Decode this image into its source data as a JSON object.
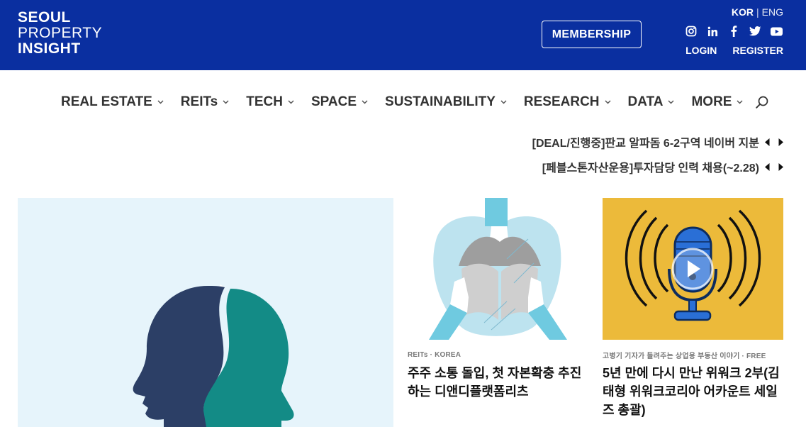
{
  "header": {
    "logo_line1": "SEOUL",
    "logo_line2": "PROPERTY",
    "logo_line3": "INSIGHT",
    "membership_label": "MEMBERSHIP",
    "lang_kor": "KOR",
    "lang_sep": "|",
    "lang_eng": "ENG",
    "login_label": "LOGIN",
    "register_label": "REGISTER",
    "socials": [
      "instagram-icon",
      "linkedin-icon",
      "facebook-icon",
      "twitter-icon",
      "youtube-icon"
    ]
  },
  "nav": {
    "items": [
      {
        "label": "REAL ESTATE"
      },
      {
        "label": "REITs"
      },
      {
        "label": "TECH"
      },
      {
        "label": "SPACE"
      },
      {
        "label": "SUSTAINABILITY"
      },
      {
        "label": "RESEARCH"
      },
      {
        "label": "DATA"
      },
      {
        "label": "MORE"
      }
    ]
  },
  "ticker": {
    "items": [
      "[DEAL/진행중]판교 알파돔 6-2구역 네이버 지분",
      "[페블스톤자산운용]투자담당 인력 채용(~2.28)"
    ]
  },
  "articles": [
    {
      "meta": "REITs · KOREA",
      "title": "주주 소통 돌입, 첫 자본확충 추진하는 디앤디플랫폼리츠"
    },
    {
      "meta": "고병기 기자가 들려주는 상업용 부동산 이야기 · FREE",
      "title": "5년 만에 다시 만난 위워크 2부(김태형 위워크코리아 어카운트 세일즈 총괄)"
    }
  ],
  "colors": {
    "header_bg": "#0a2fa0",
    "feature_bg": "#e6f4fb",
    "podcast_bg": "#ecba3a"
  }
}
